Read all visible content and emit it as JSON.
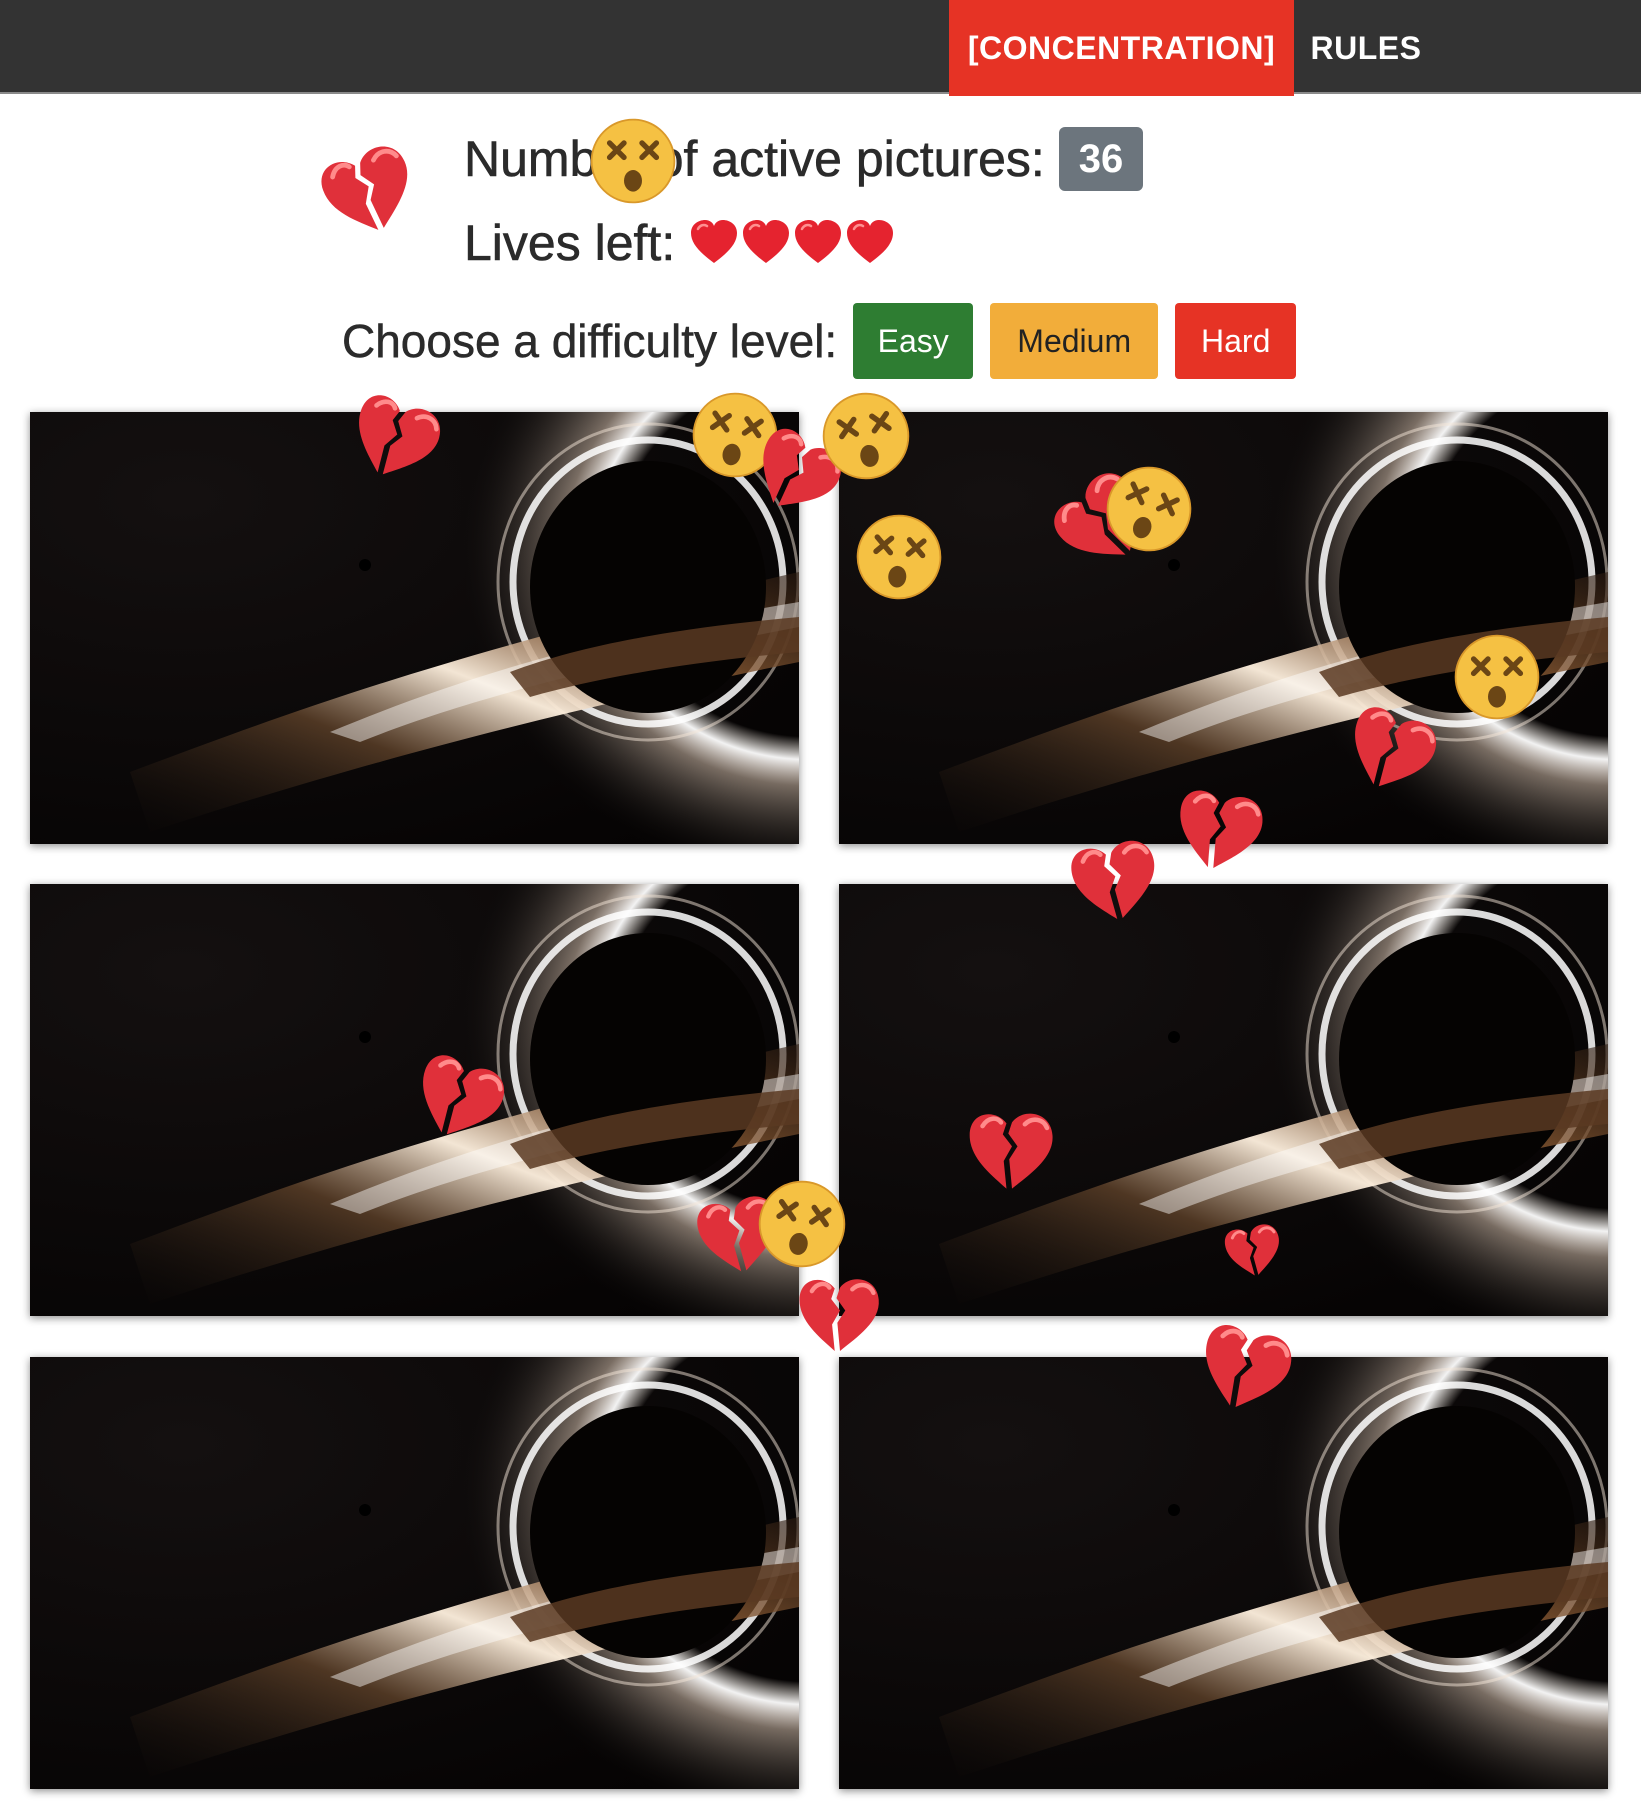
{
  "navbar": {
    "items": [
      {
        "label": "[CONCENTRATION]",
        "active": true
      },
      {
        "label": "RULES",
        "active": false
      }
    ]
  },
  "stats": {
    "active_pictures_label": "Number of active pictures:",
    "active_pictures_count": "36",
    "lives_label": "Lives left:",
    "lives": 4
  },
  "difficulty": {
    "label": "Choose a difficulty level:",
    "options": [
      {
        "label": "Easy",
        "color": "#2e7d32"
      },
      {
        "label": "Medium",
        "color": "#f2ad3a"
      },
      {
        "label": "Hard",
        "color": "#e63325"
      }
    ]
  },
  "cards": [
    {
      "image": "black-hole-picture"
    },
    {
      "image": "black-hole-picture"
    },
    {
      "image": "black-hole-picture"
    },
    {
      "image": "black-hole-picture"
    },
    {
      "image": "black-hole-picture"
    },
    {
      "image": "black-hole-picture"
    }
  ],
  "floating_emoji": {
    "broken_heart_count": 14,
    "dizzy_face_count": 8
  },
  "colors": {
    "navbar_bg": "#333333",
    "active_tab": "#e63325",
    "badge": "#6c757d"
  }
}
